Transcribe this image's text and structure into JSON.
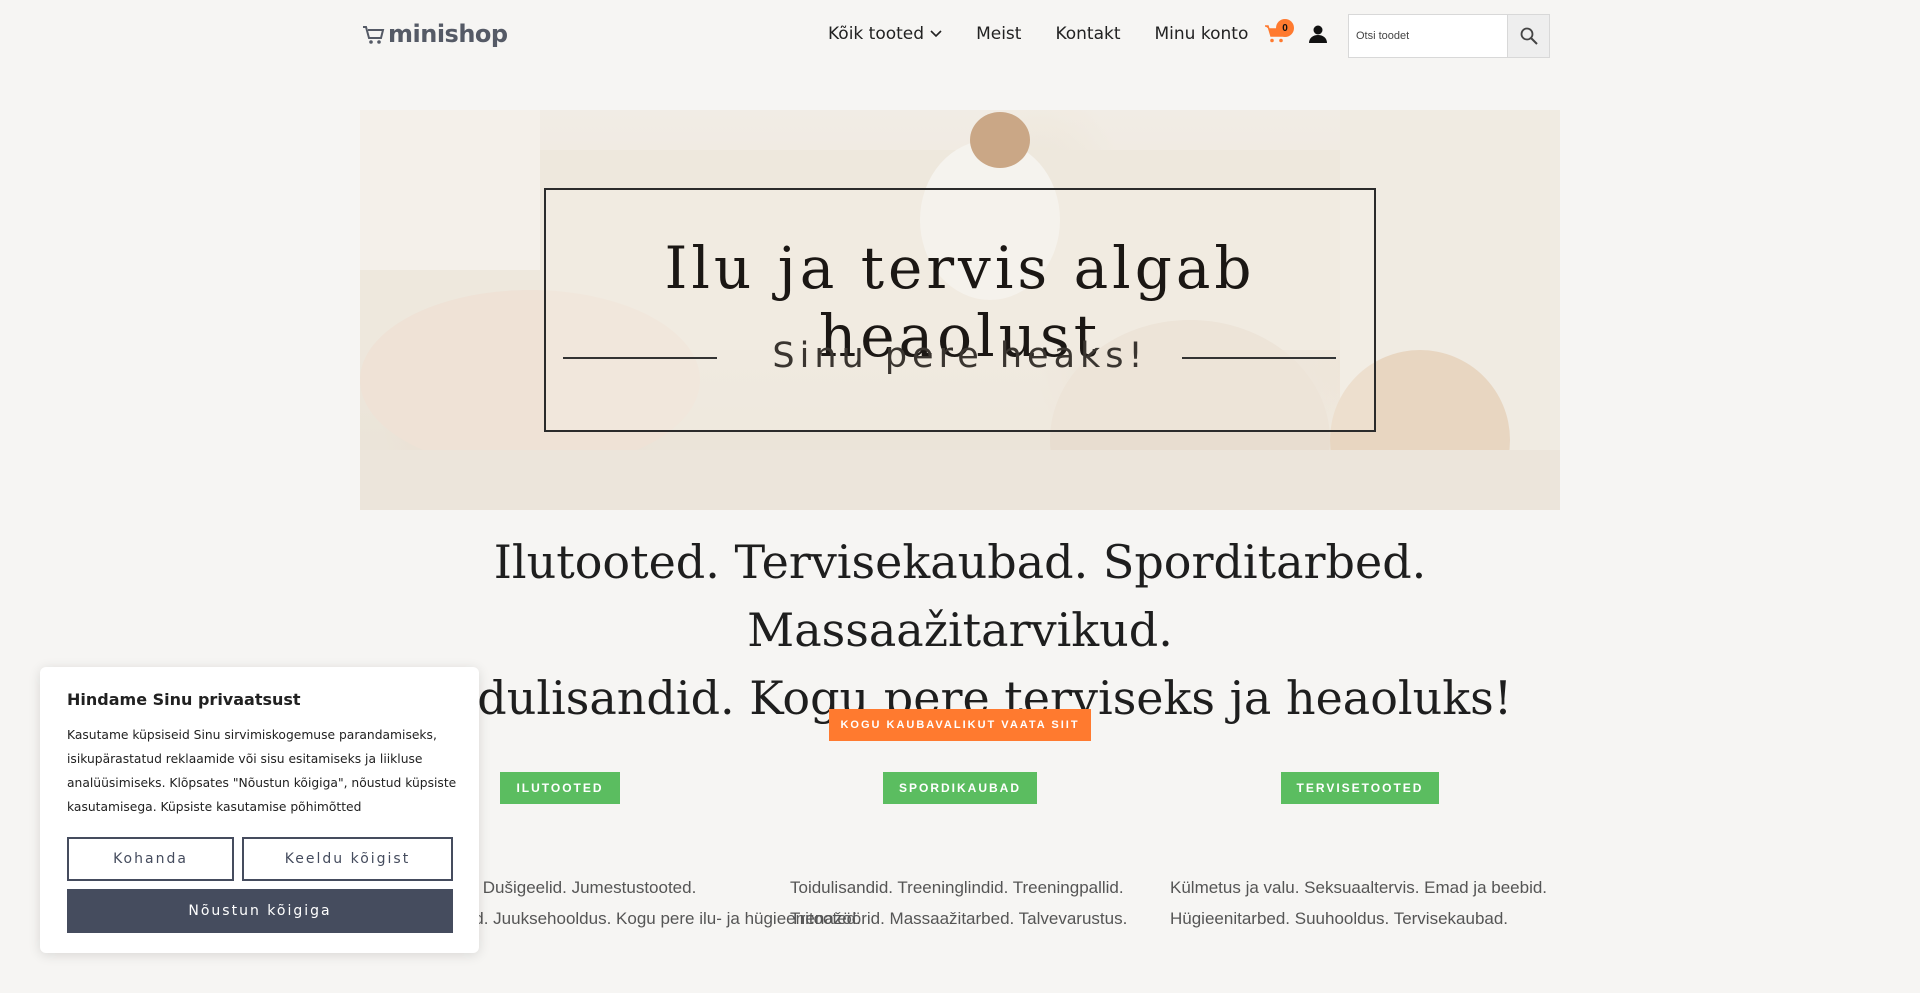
{
  "header": {
    "logo_text": "minishop",
    "nav": [
      {
        "label": "Kõik tooted",
        "has_dropdown": true
      },
      {
        "label": "Meist"
      },
      {
        "label": "Kontakt"
      },
      {
        "label": "Minu konto"
      }
    ],
    "cart_count": "0",
    "search_placeholder": "Otsi toodet"
  },
  "hero": {
    "title": "Ilu ja tervis algab heaolust",
    "subtitle": "Sinu pere heaks!"
  },
  "tagline": {
    "line1": "Ilutooted. Tervisekaubad. Sporditarbed. Massaažitarvikud.",
    "line2": "Toidulisandid. Kogu pere terviseks ja heaoluks!"
  },
  "cta_label": "KOGU KAUBAVALIKUT VAATA SIIT",
  "categories": [
    {
      "label": "ILUTOOTED",
      "line1": "Kreemid. Dušigeelid. Jumestustooted.",
      "line2": "Lõhnaõlid. Juuksehooldus. Kogu pere ilu- ja hügieenitooted."
    },
    {
      "label": "SPORDIKAUBAD",
      "line1": "Toidulisandid. Treeninglindid. Treeningpallid.",
      "line2": "Trenažöörid. Massaažitarbed. Talvevarustus."
    },
    {
      "label": "TERVISETOOTED",
      "line1": "Külmetus ja valu. Seksuaaltervis. Emad ja beebid.",
      "line2": "Hügieenitarbed. Suuhooldus. Tervisekaubad."
    }
  ],
  "cookie": {
    "title": "Hindame Sinu privaatsust",
    "text": "Kasutame küpsiseid Sinu sirvimiskogemuse parandamiseks, isikupärastatud reklaamide või sisu esitamiseks ja liikluse analüüsimiseks. Klõpsates \"Nõustun kõigiga\", nõustud küpsiste kasutamisega. Küpsiste kasutamise põhimõtted",
    "customize_label": "Kohanda",
    "reject_label": "Keeldu kõigist",
    "accept_label": "Nõustun kõigiga"
  },
  "colors": {
    "accent_orange": "#ff7a2f",
    "category_green": "#5bbd60",
    "cookie_button": "#454c5e",
    "page_background": "#f6f5f3"
  }
}
